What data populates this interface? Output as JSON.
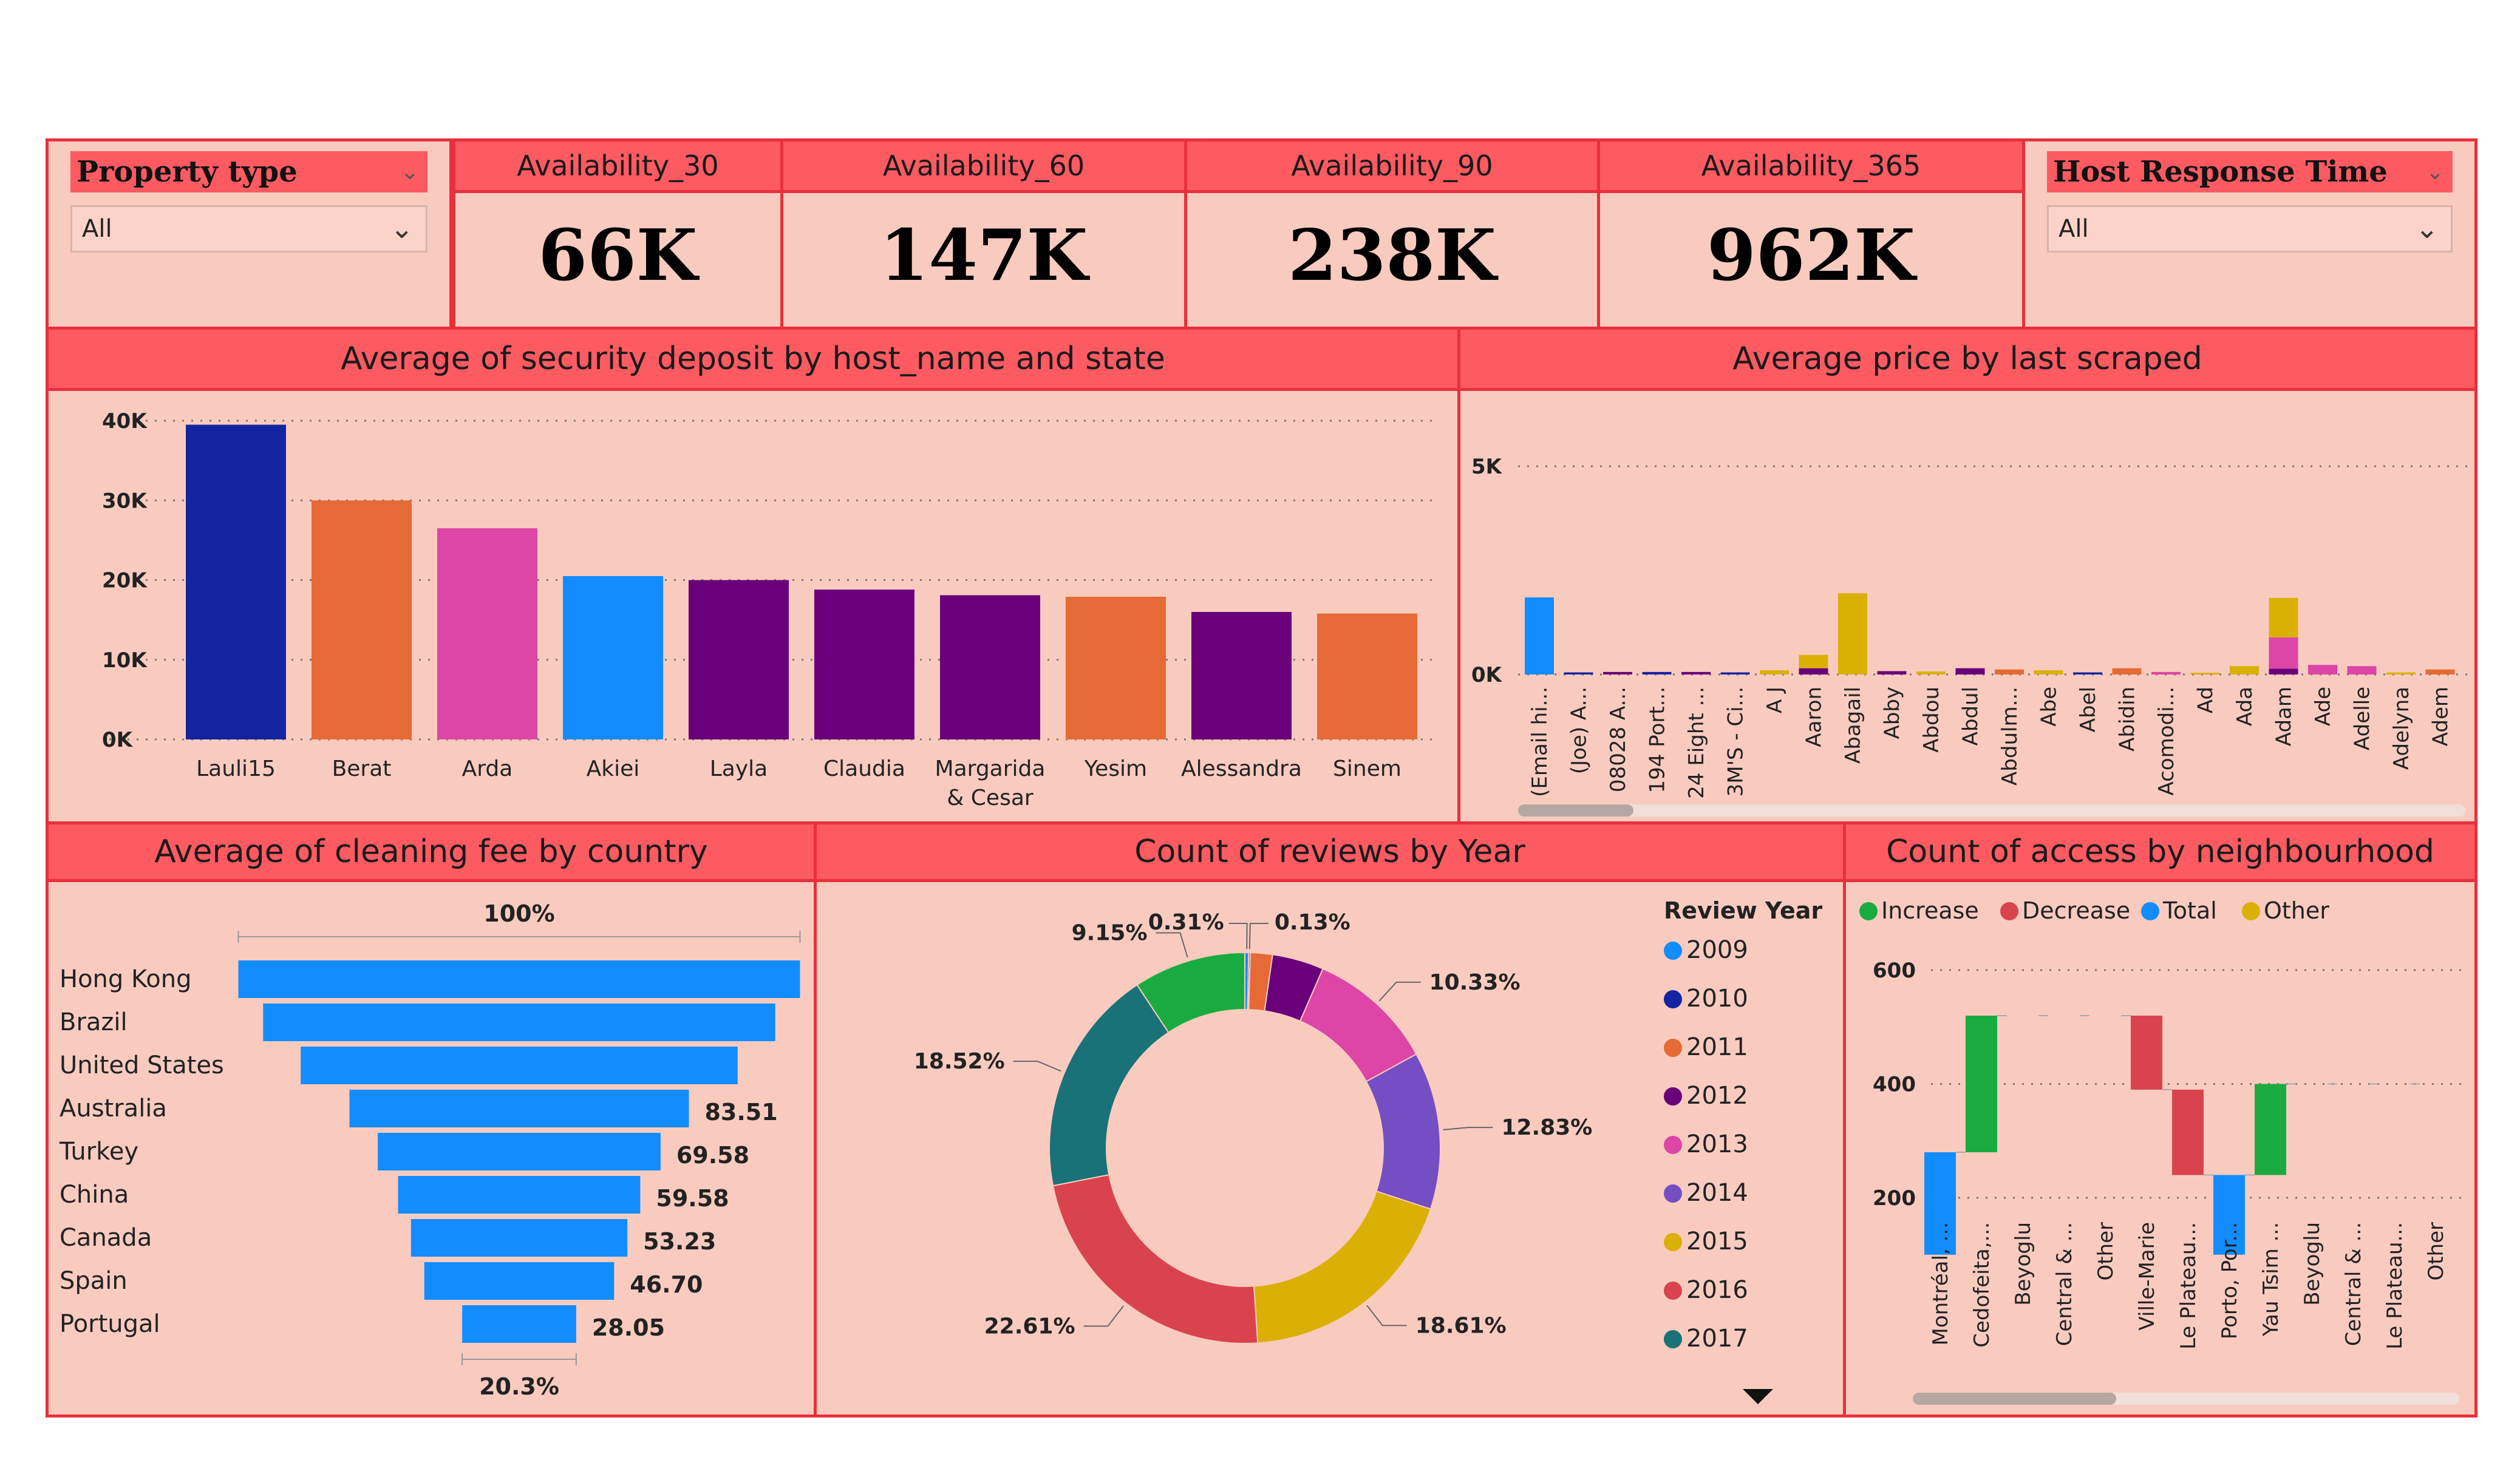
{
  "slicers": {
    "property_type": {
      "title": "Property type",
      "value": "All"
    },
    "host_response_time": {
      "title": "Host Response Time",
      "value": "All"
    }
  },
  "kpis": [
    {
      "label": "Availability_30",
      "value": "66K"
    },
    {
      "label": "Availability_60",
      "value": "147K"
    },
    {
      "label": "Availability_90",
      "value": "238K"
    },
    {
      "label": "Availability_365",
      "value": "962K"
    }
  ],
  "titles": {
    "security": "Average of security deposit by host_name and state",
    "price": "Average price by last scraped",
    "cleaning": "Average of cleaning fee by country",
    "reviews": "Count of reviews by Year",
    "access": "Count of access by neighbourhood"
  },
  "chart_data": [
    {
      "id": "security",
      "type": "bar",
      "title": "Average of security deposit by host_name and state",
      "categories": [
        "Lauli15",
        "Berat",
        "Arda",
        "Akiei",
        "Layla",
        "Claudia",
        "Margarida & Cesar",
        "Yesim",
        "Alessandra",
        "Sinem"
      ],
      "values": [
        39500,
        30000,
        26500,
        20500,
        20000,
        18800,
        18100,
        17900,
        16000,
        15800
      ],
      "colors": [
        "#1424a0",
        "#e66a35",
        "#dd45a6",
        "#128cff",
        "#6a007a",
        "#6a007a",
        "#6a007a",
        "#e66a35",
        "#6a007a",
        "#e66a35"
      ],
      "yticks": [
        "0K",
        "10K",
        "20K",
        "30K",
        "40K"
      ],
      "ylim": [
        0,
        40000
      ],
      "grid": true
    },
    {
      "id": "price",
      "type": "bar",
      "title": "Average price by last scraped",
      "categories": [
        "(Email hi...",
        "(Joe) A...",
        "08028 A...",
        "194 Port...",
        "24 Eight ...",
        "3M'S - Ci...",
        "A J",
        "Aaron",
        "Abagail",
        "Abby",
        "Abdou",
        "Abdul",
        "Abdulm...",
        "Abe",
        "Abel",
        "Abidin",
        "Acomodi...",
        "Ad",
        "Ada",
        "Adam",
        "Ade",
        "Adelle",
        "Adelyna",
        "Adem"
      ],
      "series": [
        {
          "name": "2009",
          "color": "#128cff",
          "values": [
            1850,
            0,
            0,
            0,
            0,
            0,
            0,
            0,
            0,
            0,
            0,
            0,
            0,
            0,
            0,
            0,
            0,
            0,
            0,
            0,
            0,
            0,
            0,
            0
          ]
        },
        {
          "name": "2010",
          "color": "#1424a0",
          "values": [
            0,
            50,
            0,
            60,
            0,
            50,
            0,
            0,
            0,
            0,
            0,
            0,
            0,
            0,
            50,
            0,
            0,
            0,
            0,
            0,
            0,
            0,
            0,
            0
          ]
        },
        {
          "name": "2011",
          "color": "#e66a35",
          "values": [
            0,
            0,
            0,
            0,
            0,
            0,
            0,
            0,
            0,
            0,
            0,
            0,
            120,
            0,
            0,
            150,
            0,
            0,
            0,
            0,
            0,
            0,
            0,
            120
          ]
        },
        {
          "name": "2012",
          "color": "#6a007a",
          "values": [
            0,
            0,
            60,
            0,
            60,
            0,
            0,
            150,
            0,
            80,
            0,
            150,
            0,
            0,
            0,
            0,
            0,
            0,
            0,
            140,
            0,
            0,
            0,
            0
          ]
        },
        {
          "name": "2013",
          "color": "#dd45a6",
          "values": [
            0,
            0,
            0,
            0,
            0,
            0,
            0,
            0,
            0,
            0,
            0,
            0,
            0,
            0,
            0,
            0,
            60,
            0,
            0,
            750,
            230,
            200,
            0,
            0
          ]
        },
        {
          "name": "2015",
          "color": "#dbb005",
          "values": [
            0,
            0,
            0,
            0,
            0,
            0,
            100,
            320,
            1950,
            0,
            70,
            0,
            0,
            100,
            0,
            0,
            0,
            40,
            200,
            950,
            0,
            0,
            50,
            0
          ]
        }
      ],
      "yticks": [
        "0K",
        "5K"
      ],
      "ylim": [
        0,
        5000
      ],
      "grid": true
    },
    {
      "id": "cleaning",
      "type": "bar",
      "title": "Average of cleaning fee by country",
      "orientation": "funnel",
      "categories": [
        "Hong Kong",
        "Brazil",
        "United States",
        "Australia",
        "Turkey",
        "China",
        "Canada",
        "Spain",
        "Portugal"
      ],
      "values": [
        138.2,
        126.0,
        107.5,
        83.51,
        69.58,
        59.58,
        53.23,
        46.7,
        28.05
      ],
      "labels": [
        "",
        "",
        "",
        "83.51",
        "69.58",
        "59.58",
        "53.23",
        "46.70",
        "28.05"
      ],
      "top_label": "100%",
      "bottom_label": "20.3%",
      "color": "#128cff"
    },
    {
      "id": "reviews",
      "type": "pie",
      "title": "Count of reviews by Year",
      "legend_title": "Review Year",
      "legend_position": "right",
      "categories": [
        "2009",
        "2010",
        "2011",
        "2012",
        "2013",
        "2014",
        "2015",
        "2016",
        "2017"
      ],
      "values": [
        0.31,
        0.13,
        1.8,
        4.2,
        10.33,
        12.83,
        18.61,
        22.61,
        18.52,
        9.15
      ],
      "slices": [
        {
          "name": "2009",
          "value": 0.31,
          "color": "#128cff",
          "label": "0.31%"
        },
        {
          "name": "2010",
          "value": 0.13,
          "color": "#1424a0",
          "label": "0.13%"
        },
        {
          "name": "2011",
          "value": 1.8,
          "color": "#e66a35",
          "label": ""
        },
        {
          "name": "2012",
          "value": 4.2,
          "color": "#6a007a",
          "label": ""
        },
        {
          "name": "2013",
          "value": 10.33,
          "color": "#dd45a6",
          "label": "10.33%"
        },
        {
          "name": "2014",
          "value": 12.83,
          "color": "#744ec2",
          "label": "12.83%"
        },
        {
          "name": "2015",
          "value": 18.61,
          "color": "#dbb005",
          "label": "18.61%"
        },
        {
          "name": "2016",
          "value": 22.61,
          "color": "#d9434e",
          "label": "22.61%"
        },
        {
          "name": "2017",
          "value": 18.52,
          "color": "#197278",
          "label": "18.52%"
        },
        {
          "name": "",
          "value": 9.15,
          "color": "#1aab40",
          "label": "9.15%"
        }
      ]
    },
    {
      "id": "access",
      "type": "bar",
      "subtype": "waterfall",
      "title": "Count of access by neighbourhood",
      "legend": [
        {
          "name": "Increase",
          "color": "#1aab40"
        },
        {
          "name": "Decrease",
          "color": "#d9434e"
        },
        {
          "name": "Total",
          "color": "#128cff"
        },
        {
          "name": "Other",
          "color": "#dbb005"
        }
      ],
      "legend_position": "top-left",
      "categories": [
        "Montréal, ...",
        "Cedofeita,...",
        "Beyoglu",
        "Central & ...",
        "Other",
        "Ville-Marie",
        "Le Plateau...",
        "Porto, Por...",
        "Yau Tsim ...",
        "Beyoglu",
        "Central & ...",
        "Le Plateau...",
        "Other"
      ],
      "bars": [
        {
          "start": 100,
          "end": 280,
          "kind": "Total"
        },
        {
          "start": 280,
          "end": 520,
          "kind": "Increase"
        },
        {
          "start": 520,
          "end": 520,
          "kind": "Increase"
        },
        {
          "start": 520,
          "end": 520,
          "kind": "Increase"
        },
        {
          "start": 520,
          "end": 520,
          "kind": "Increase"
        },
        {
          "start": 520,
          "end": 390,
          "kind": "Decrease"
        },
        {
          "start": 390,
          "end": 240,
          "kind": "Decrease"
        },
        {
          "start": 100,
          "end": 240,
          "kind": "Total"
        },
        {
          "start": 240,
          "end": 400,
          "kind": "Increase"
        },
        {
          "start": 400,
          "end": 400,
          "kind": "Increase"
        },
        {
          "start": 400,
          "end": 400,
          "kind": "Increase"
        },
        {
          "start": 400,
          "end": 400,
          "kind": "Increase"
        },
        {
          "start": 400,
          "end": 400,
          "kind": "Increase"
        }
      ],
      "yticks": [
        "200",
        "400",
        "600"
      ],
      "ylim": [
        100,
        600
      ],
      "grid": true
    }
  ]
}
